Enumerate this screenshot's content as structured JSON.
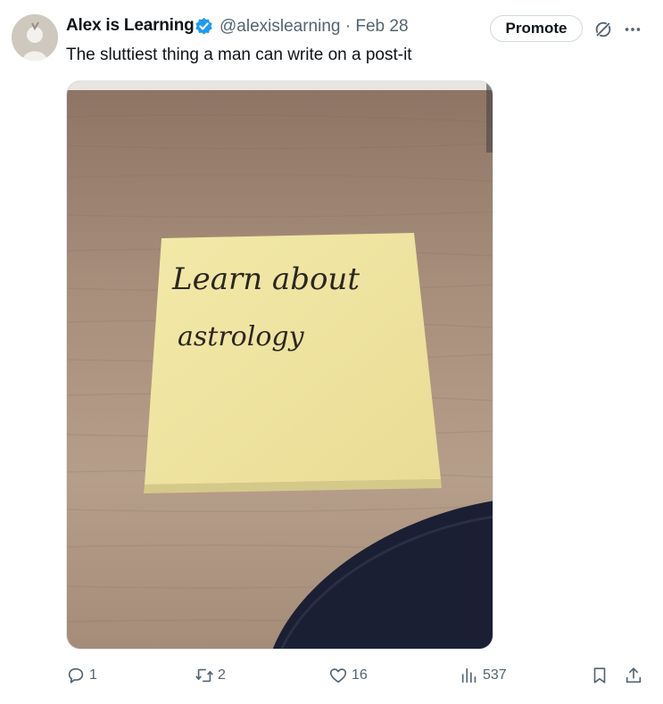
{
  "author": {
    "name": "Alex is Learning",
    "handle": "@alexislearning",
    "date": "Feb 28",
    "verified": true
  },
  "header": {
    "separator": "·",
    "promote_label": "Promote"
  },
  "tweet": {
    "text": "The sluttiest thing a man can write on a post-it"
  },
  "media": {
    "note_line1": "Learn about",
    "note_line2": "astrology"
  },
  "actions": {
    "replies": "1",
    "retweets": "2",
    "likes": "16",
    "views": "537"
  },
  "icons": [
    "verified-badge-icon",
    "grok-icon",
    "more-options-icon",
    "reply-icon",
    "retweet-icon",
    "like-icon",
    "views-icon",
    "bookmark-icon",
    "share-icon"
  ],
  "colors": {
    "accent": "#1d9bf0",
    "secondary_text": "#536471",
    "primary_text": "#0f1419"
  }
}
